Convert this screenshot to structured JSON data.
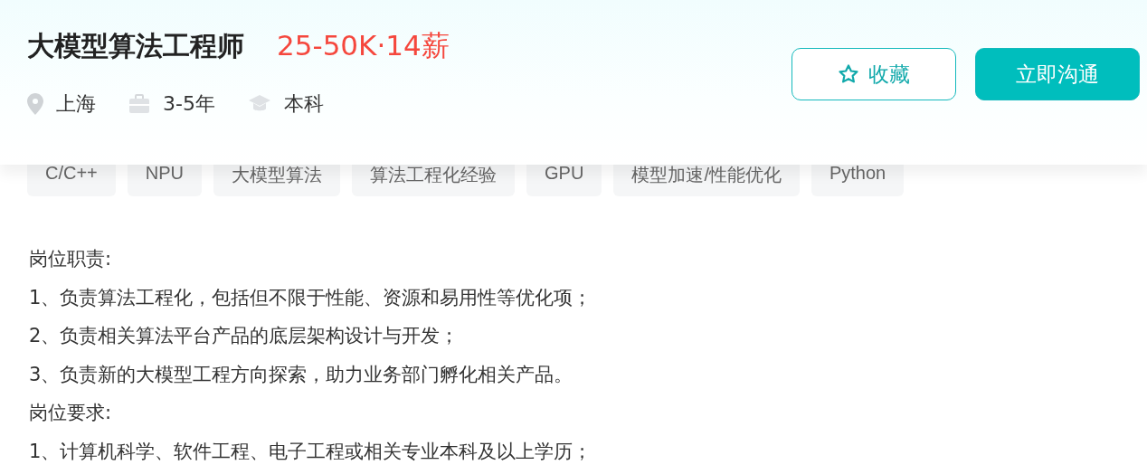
{
  "job": {
    "title": "大模型算法工程师",
    "salary": "25-50K·14薪",
    "meta": [
      {
        "kind": "location",
        "text": "上海"
      },
      {
        "kind": "experience",
        "text": "3-5年"
      },
      {
        "kind": "degree",
        "text": "本科"
      }
    ]
  },
  "buttons": [
    {
      "kind": "outline",
      "label": "收藏"
    },
    {
      "kind": "primary",
      "label": "立即沟通"
    }
  ],
  "tags": [
    "C/C++",
    "NPU",
    "大模型算法",
    "算法工程化经验",
    "GPU",
    "模型加速/性能优化",
    "Python"
  ],
  "description": [
    "岗位职责:",
    "1、负责算法工程化，包括但不限于性能、资源和易用性等优化项；",
    "2、负责相关算法平台产品的底层架构设计与开发；",
    "3、负责新的大模型工程方向探索，助力业务部门孵化相关产品。",
    "岗位要求:",
    "1、计算机科学、软件工程、电子工程或相关专业本科及以上学历；"
  ]
}
